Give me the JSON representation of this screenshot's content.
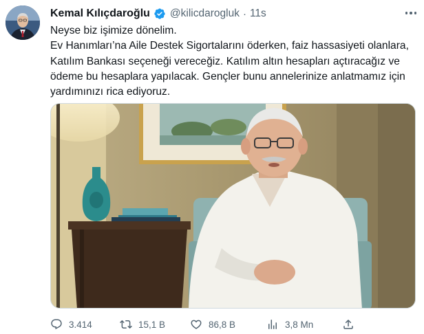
{
  "author": {
    "name": "Kemal Kılıçdaroğlu",
    "handle": "@kilicdarogluk",
    "time": "11s",
    "separator": "·",
    "verified": true
  },
  "tweet": {
    "paragraphs": [
      "Neyse biz işimize dönelim.",
      "Ev Hanımları’na Aile Destek Sigortalarını öderken, faiz hassasiyeti olanlara, Katılım Bankası seçeneği vereceğiz. Katılım altın hesapları açtıracağız ve ödeme bu hesaplara yapılacak. Gençler bunu annelerinize anlatmamız için yardımınızı rica ediyoruz."
    ]
  },
  "media": {
    "type": "video-thumbnail"
  },
  "stats": {
    "replies": "3.414",
    "retweets": "15,1 B",
    "likes": "86,8 B",
    "views": "3,8 Mn"
  },
  "colors": {
    "text": "#0f1419",
    "secondary": "#536471",
    "verified_blue": "#1d9bf0",
    "border": "#cfd9de"
  },
  "icons": {
    "reply": "reply-icon",
    "retweet": "retweet-icon",
    "like": "heart-icon",
    "views": "analytics-icon",
    "share": "share-icon",
    "verified": "verified-badge-icon",
    "more": "more-icon"
  }
}
